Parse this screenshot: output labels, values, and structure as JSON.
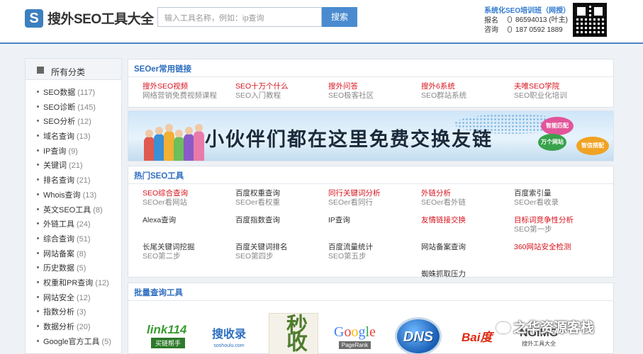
{
  "header": {
    "logo_mark": "S",
    "logo_text": "搜外SEO工具大全",
    "search_placeholder": "输入工具名称，例如：ip查询",
    "search_button": "搜索",
    "promo": {
      "title": "系统化SEO培训班（网授）",
      "label": "报名咨询",
      "phone1": "86594013 (叶主)",
      "phone2": "187 0592 1889"
    }
  },
  "sidebar": {
    "title": "所有分类",
    "items": [
      {
        "label": "SEO数据",
        "count": "(117)"
      },
      {
        "label": "SEO诊断",
        "count": "(145)"
      },
      {
        "label": "SEO分析",
        "count": "(12)"
      },
      {
        "label": "域名查询",
        "count": "(13)"
      },
      {
        "label": "IP查询",
        "count": "(9)"
      },
      {
        "label": "关键词",
        "count": "(21)"
      },
      {
        "label": "排名查询",
        "count": "(21)"
      },
      {
        "label": "Whois查询",
        "count": "(13)"
      },
      {
        "label": "英文SEO工具",
        "count": "(8)"
      },
      {
        "label": "外链工具",
        "count": "(24)"
      },
      {
        "label": "综合查询",
        "count": "(51)"
      },
      {
        "label": "网站备案",
        "count": "(8)"
      },
      {
        "label": "历史数据",
        "count": "(5)"
      },
      {
        "label": "权重和PR查询",
        "count": "(12)"
      },
      {
        "label": "网站安全",
        "count": "(12)"
      },
      {
        "label": "指数分析",
        "count": "(3)"
      },
      {
        "label": "数据分析",
        "count": "(20)"
      },
      {
        "label": "Google官方工具",
        "count": "(5)"
      }
    ]
  },
  "common_links": {
    "title": "SEOer常用链接",
    "items": [
      {
        "title": "搜外SEO视频",
        "sub": "网络营销免费视频课程"
      },
      {
        "title": "SEO十万个什么",
        "sub": "SEO入门教程"
      },
      {
        "title": "搜外问答",
        "sub": "SEO极客社区"
      },
      {
        "title": "搜外6系统",
        "sub": "SEO群站系统"
      },
      {
        "title": "夫唯SEO学院",
        "sub": "SEO职业化培训"
      }
    ]
  },
  "banner": {
    "text": "小伙伴们都在这里免费交换友链",
    "bubble1": "智能匹配",
    "bubble2": "万个网站",
    "bubble3": "智信搭配"
  },
  "hot_tools": {
    "title": "热门SEO工具",
    "items": [
      {
        "title": "SEO综合查询",
        "sub": "SEOer看网站",
        "red": true
      },
      {
        "title": "百度权重查询",
        "sub": "SEOer看权重",
        "red": false
      },
      {
        "title": "同行关键词分析",
        "sub": "SEOer看同行",
        "red": true
      },
      {
        "title": "外链分析",
        "sub": "SEOer看外链",
        "red": true
      },
      {
        "title": "百度索引量",
        "sub": "SEOer看收录",
        "red": false
      },
      {
        "title": "Alexa查询",
        "sub": "",
        "red": false
      },
      {
        "title": "百度指数查询",
        "sub": "",
        "red": false
      },
      {
        "title": "IP查询",
        "sub": "",
        "red": false
      },
      {
        "title": "友情链接交换",
        "sub": "",
        "red": true
      },
      {
        "title": "目标词竞争性分析",
        "sub": "SEO第一步",
        "red": true
      },
      {
        "title": "长尾关键词挖掘",
        "sub": "SEO第二步",
        "red": false
      },
      {
        "title": "百度关键词排名",
        "sub": "SEO第四步",
        "red": false
      },
      {
        "title": "百度流量统计",
        "sub": "SEO第五步",
        "red": false
      },
      {
        "title": "网站备案查询",
        "sub": "",
        "red": false
      },
      {
        "title": "360网站安全检测",
        "sub": "",
        "red": true
      },
      {
        "title": "",
        "sub": "",
        "red": false
      },
      {
        "title": "",
        "sub": "",
        "red": false
      },
      {
        "title": "",
        "sub": "",
        "red": false
      },
      {
        "title": "蜘蛛抓取压力",
        "sub": "",
        "red": false
      },
      {
        "title": "",
        "sub": "",
        "red": false
      }
    ]
  },
  "bulk_tools": {
    "title": "批量查询工具",
    "logos": {
      "link114": "link114",
      "link114_sub": "买链帮手",
      "soshoulu": "搜收录",
      "soshoulu_sub": "soshoulu.com",
      "miaoshou": "秒收录",
      "google": "Google",
      "google_sub": "PageRank",
      "dns": "DNS",
      "baidu": "Bai度",
      "ngimg": "NGIMG",
      "ngimg_sub": "搜外工具大全"
    }
  },
  "watermark": "之华资源客栈"
}
